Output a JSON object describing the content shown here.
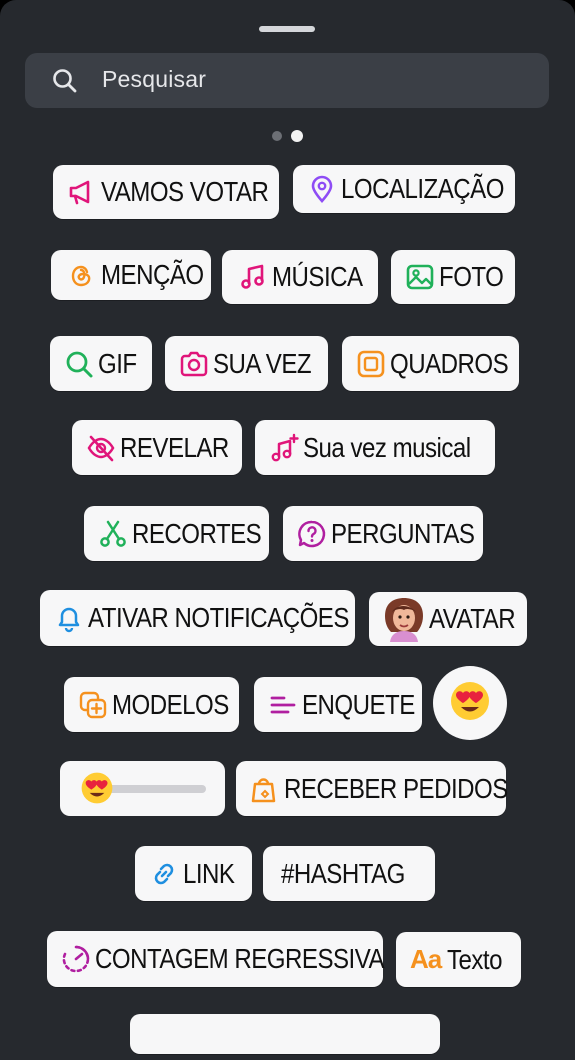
{
  "search": {
    "placeholder": "Pesquisar"
  },
  "pager": {
    "count": 2,
    "active": 1
  },
  "stickers": {
    "vamos_votar": "VAMOS VOTAR",
    "localizacao": "LOCALIZAÇÃO",
    "mencao": "MENÇÃO",
    "musica": "MÚSICA",
    "foto": "FOTO",
    "gif": "GIF",
    "sua_vez": "SUA VEZ",
    "quadros": "QUADROS",
    "revelar": "REVELAR",
    "sua_vez_musical": "Sua vez musical",
    "recortes": "RECORTES",
    "perguntas": "PERGUNTAS",
    "ativar_notificacoes": "ATIVAR NOTIFICAÇÕES",
    "avatar": "AVATAR",
    "modelos": "MODELOS",
    "enquete": "ENQUETE",
    "receber_pedidos": "RECEBER PEDIDOS",
    "link": "LINK",
    "hashtag": "#HASHTAG",
    "contagem_regressiva": "CONTAGEM REGRESSIVA",
    "texto": "Texto",
    "texto_prefix": "Aa"
  },
  "colors": {
    "sheet_bg": "#26292e",
    "search_bg": "#3b3f46",
    "sticker_bg": "#f7f7f8",
    "pink": "#e0157a",
    "purple": "#8e4cf5",
    "orange": "#f5911e",
    "green": "#20b15a",
    "blue": "#1f8fe0"
  },
  "icons": [
    "search-icon",
    "megaphone-icon",
    "location-pin-icon",
    "threads-mention-icon",
    "music-note-icon",
    "photo-icon",
    "gif-search-icon",
    "camera-icon",
    "frame-icon",
    "eye-off-icon",
    "music-plus-icon",
    "scissors-icon",
    "question-bubble-icon",
    "bell-icon",
    "avatar-image",
    "templates-icon",
    "poll-lines-icon",
    "heart-eyes-emoji-icon",
    "shopping-bag-icon",
    "link-icon",
    "countdown-icon"
  ]
}
